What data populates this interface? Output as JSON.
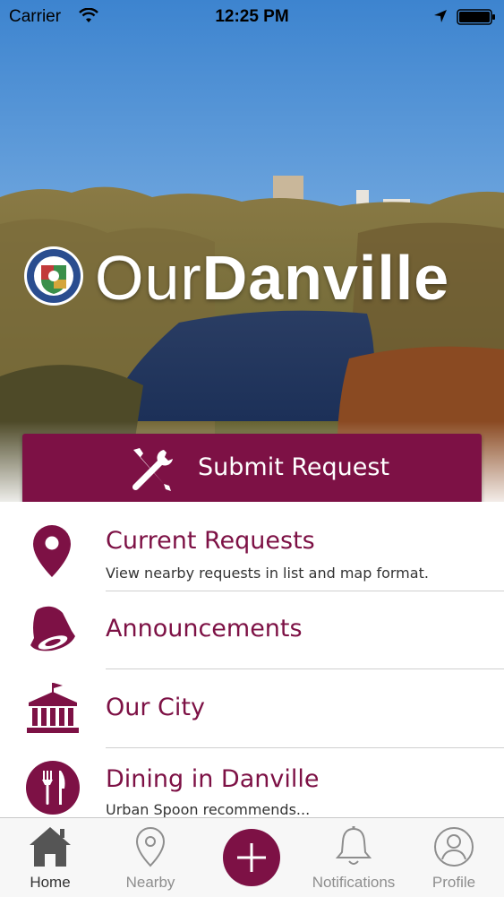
{
  "status_bar": {
    "carrier": "Carrier",
    "time": "12:25 PM",
    "wifi_icon": "wifi-icon",
    "location_icon": "location-arrow-icon",
    "battery_icon": "battery-icon"
  },
  "brand": {
    "prefix": "Our",
    "name": "Danville",
    "seal_icon": "city-seal-icon"
  },
  "submit": {
    "label": "Submit Request",
    "icon": "wrench-screwdriver-icon"
  },
  "menu": {
    "items": [
      {
        "title": "Current Requests",
        "subtitle": "View nearby requests in list and map format.",
        "icon": "map-pin-icon"
      },
      {
        "title": "Announcements",
        "subtitle": "",
        "icon": "bell-icon"
      },
      {
        "title": "Our City",
        "subtitle": "",
        "icon": "city-hall-icon"
      },
      {
        "title": "Dining in Danville",
        "subtitle": "Urban Spoon recommends...",
        "icon": "fork-knife-icon"
      }
    ]
  },
  "tabs": [
    {
      "label": "Home",
      "icon": "home-icon",
      "active": true
    },
    {
      "label": "Nearby",
      "icon": "map-pin-outline-icon",
      "active": false
    },
    {
      "label": "",
      "icon": "plus-icon",
      "active": false
    },
    {
      "label": "Notifications",
      "icon": "bell-outline-icon",
      "active": false
    },
    {
      "label": "Profile",
      "icon": "profile-icon",
      "active": false
    }
  ],
  "colors": {
    "brand": "#7d1145",
    "tab_active": "#333333",
    "tab_inactive": "#8e8e8e"
  }
}
